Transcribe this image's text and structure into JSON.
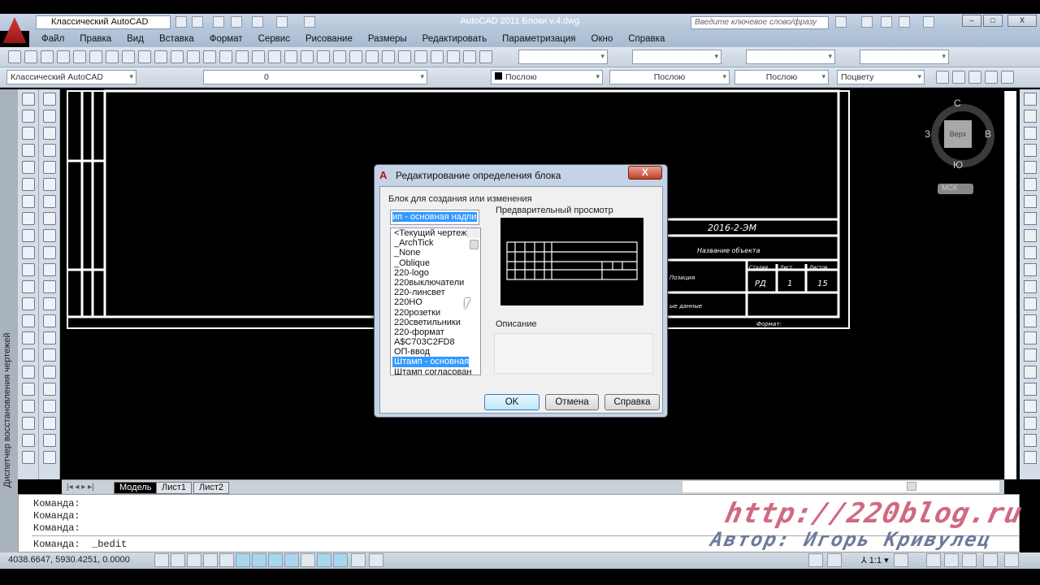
{
  "titlebar": {
    "workspace": "Классический AutoCAD",
    "title": "AutoCAD 2011    Блоки v.4.dwg",
    "search_placeholder": "Введите ключевое слово/фразу",
    "min": "–",
    "max": "□",
    "close": "X"
  },
  "menu": [
    "Файл",
    "Правка",
    "Вид",
    "Вставка",
    "Формат",
    "Сервис",
    "Рисование",
    "Размеры",
    "Редактировать",
    "Параметризация",
    "Окно",
    "Справка"
  ],
  "toolbar2": {
    "workspace": "Классический AutoCAD",
    "layer": "0",
    "color": "Послою",
    "linetype": "Послою",
    "lineweight": "Послою",
    "plotstyle": "Поцвету"
  },
  "left_panel_label": "Диспетчер восстановления чертежей",
  "viewcube": {
    "n": "С",
    "s": "Ю",
    "w": "З",
    "e": "В",
    "face": "Верх",
    "ucs": "МСК"
  },
  "title_block": {
    "code": "2016-2-ЭМ",
    "object_name": "Название объекта",
    "stage_hdr": "Стадия",
    "sheet_hdr": "Лист",
    "sheets_hdr": "Листов",
    "stage": "РД",
    "sheet": "1",
    "sheets": "15",
    "position": "Позиция",
    "data": "ые данные",
    "format": "Формат:"
  },
  "tabs": [
    "Модель",
    "Лист1",
    "Лист2"
  ],
  "command": {
    "lines": [
      "Команда:",
      "Команда:",
      "Команда:"
    ],
    "current": "Команда:  _bedit"
  },
  "status": {
    "coords": "4038.6647, 5930.4251, 0.0000",
    "scale": "1:1"
  },
  "watermark": {
    "url": "http://220blog.ru",
    "author": "Автор: Игорь Кривулец"
  },
  "dialog": {
    "title": "Редактирование определения блока",
    "close": "X",
    "block_label": "Блок для создания или изменения",
    "name_value": "ип - основная надпись",
    "items": [
      "<Текущий чертеж>",
      "_ArchTick",
      "_None",
      "_Oblique",
      "220-logo",
      "220выключатели",
      "220-линсвет",
      "220НО",
      "220розетки",
      "220светильники",
      "220-формат",
      "A$C703C2FD8",
      "ОП-ввод",
      "Штамп - основная н",
      "Штамп согласован"
    ],
    "selected_index": 13,
    "preview_label": "Предварительный просмотр",
    "description_label": "Описание",
    "ok": "OK",
    "cancel": "Отмена",
    "help": "Справка"
  },
  "colors": {
    "accent": "#3399ff",
    "watermark_url": "#d06a80",
    "watermark_author": "#6e7a9c"
  }
}
